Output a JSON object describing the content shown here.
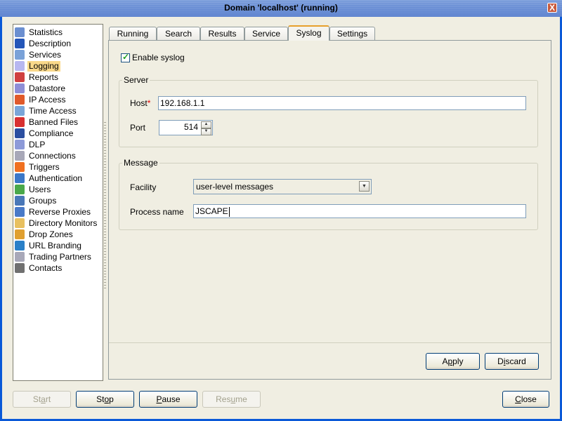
{
  "window": {
    "title": "Domain 'localhost' (running)",
    "close_glyph": "X"
  },
  "sidebar": {
    "selected": "Logging",
    "items": [
      {
        "label": "Statistics",
        "icon": "statistics-icon",
        "color": "#6b8fd0"
      },
      {
        "label": "Description",
        "icon": "person-icon",
        "color": "#2456b8"
      },
      {
        "label": "Services",
        "icon": "services-icon",
        "color": "#7aa2d8"
      },
      {
        "label": "Logging",
        "icon": "speech-bubble-icon",
        "color": "#b7b7f0"
      },
      {
        "label": "Reports",
        "icon": "bar-chart-icon",
        "color": "#d04040"
      },
      {
        "label": "Datastore",
        "icon": "database-icon",
        "color": "#8e8ed6"
      },
      {
        "label": "IP Access",
        "icon": "firewall-icon",
        "color": "#e05a2a"
      },
      {
        "label": "Time Access",
        "icon": "clock-icon",
        "color": "#7aa6d8"
      },
      {
        "label": "Banned Files",
        "icon": "banned-file-icon",
        "color": "#d83030"
      },
      {
        "label": "Compliance",
        "icon": "officer-icon",
        "color": "#2b4fa0"
      },
      {
        "label": "DLP",
        "icon": "shield-icon",
        "color": "#8d9ad8"
      },
      {
        "label": "Connections",
        "icon": "gear-icon",
        "color": "#a8a8b8"
      },
      {
        "label": "Triggers",
        "icon": "trigger-arrow-icon",
        "color": "#f07020"
      },
      {
        "label": "Authentication",
        "icon": "id-card-icon",
        "color": "#3b78c8"
      },
      {
        "label": "Users",
        "icon": "user-icon",
        "color": "#4aa84a"
      },
      {
        "label": "Groups",
        "icon": "group-icon",
        "color": "#4a78b8"
      },
      {
        "label": "Reverse Proxies",
        "icon": "network-icon",
        "color": "#4a7ac8"
      },
      {
        "label": "Directory Monitors",
        "icon": "folder-clock-icon",
        "color": "#e8c060"
      },
      {
        "label": "Drop Zones",
        "icon": "box-icon",
        "color": "#e0a030"
      },
      {
        "label": "URL Branding",
        "icon": "globe-icon",
        "color": "#2a80c8"
      },
      {
        "label": "Trading Partners",
        "icon": "gear-icon",
        "color": "#a8a8b8"
      },
      {
        "label": "Contacts",
        "icon": "address-book-icon",
        "color": "#707070"
      }
    ]
  },
  "tabs": {
    "active": "Syslog",
    "items": [
      "Running",
      "Search",
      "Results",
      "Service",
      "Syslog",
      "Settings"
    ]
  },
  "syslog": {
    "enable_label": "Enable syslog",
    "enable_checked": true,
    "server": {
      "legend": "Server",
      "host_label": "Host",
      "host_required_mark": "*",
      "host_value": "192.168.1.1",
      "port_label": "Port",
      "port_value": "514",
      "spin_up": "▲",
      "spin_down": "▼"
    },
    "message": {
      "legend": "Message",
      "facility_label": "Facility",
      "facility_value": "user-level messages",
      "dropdown_glyph": "▼",
      "process_label": "Process name",
      "process_value": "JSCAPE"
    }
  },
  "panel_buttons": {
    "apply": {
      "pre": "A",
      "mnemonic": "p",
      "post": "ply"
    },
    "discard": {
      "pre": "D",
      "mnemonic": "i",
      "post": "scard"
    }
  },
  "bottom_buttons": {
    "start": {
      "pre": "St",
      "mnemonic": "a",
      "post": "rt",
      "enabled": false
    },
    "stop": {
      "pre": "St",
      "mnemonic": "o",
      "post": "p",
      "enabled": true
    },
    "pause": {
      "pre": "",
      "mnemonic": "P",
      "post": "ause",
      "enabled": true
    },
    "resume": {
      "pre": "Res",
      "mnemonic": "u",
      "post": "me",
      "enabled": false
    },
    "close": {
      "pre": "",
      "mnemonic": "C",
      "post": "lose",
      "enabled": true
    }
  }
}
